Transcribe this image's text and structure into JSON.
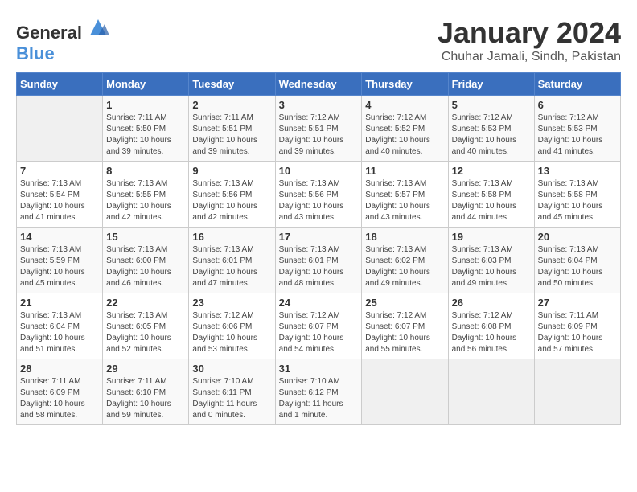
{
  "header": {
    "logo_general": "General",
    "logo_blue": "Blue",
    "month": "January 2024",
    "location": "Chuhar Jamali, Sindh, Pakistan"
  },
  "days_of_week": [
    "Sunday",
    "Monday",
    "Tuesday",
    "Wednesday",
    "Thursday",
    "Friday",
    "Saturday"
  ],
  "weeks": [
    [
      {
        "day": "",
        "sunrise": "",
        "sunset": "",
        "daylight": ""
      },
      {
        "day": "1",
        "sunrise": "Sunrise: 7:11 AM",
        "sunset": "Sunset: 5:50 PM",
        "daylight": "Daylight: 10 hours and 39 minutes."
      },
      {
        "day": "2",
        "sunrise": "Sunrise: 7:11 AM",
        "sunset": "Sunset: 5:51 PM",
        "daylight": "Daylight: 10 hours and 39 minutes."
      },
      {
        "day": "3",
        "sunrise": "Sunrise: 7:12 AM",
        "sunset": "Sunset: 5:51 PM",
        "daylight": "Daylight: 10 hours and 39 minutes."
      },
      {
        "day": "4",
        "sunrise": "Sunrise: 7:12 AM",
        "sunset": "Sunset: 5:52 PM",
        "daylight": "Daylight: 10 hours and 40 minutes."
      },
      {
        "day": "5",
        "sunrise": "Sunrise: 7:12 AM",
        "sunset": "Sunset: 5:53 PM",
        "daylight": "Daylight: 10 hours and 40 minutes."
      },
      {
        "day": "6",
        "sunrise": "Sunrise: 7:12 AM",
        "sunset": "Sunset: 5:53 PM",
        "daylight": "Daylight: 10 hours and 41 minutes."
      }
    ],
    [
      {
        "day": "7",
        "sunrise": "Sunrise: 7:13 AM",
        "sunset": "Sunset: 5:54 PM",
        "daylight": "Daylight: 10 hours and 41 minutes."
      },
      {
        "day": "8",
        "sunrise": "Sunrise: 7:13 AM",
        "sunset": "Sunset: 5:55 PM",
        "daylight": "Daylight: 10 hours and 42 minutes."
      },
      {
        "day": "9",
        "sunrise": "Sunrise: 7:13 AM",
        "sunset": "Sunset: 5:56 PM",
        "daylight": "Daylight: 10 hours and 42 minutes."
      },
      {
        "day": "10",
        "sunrise": "Sunrise: 7:13 AM",
        "sunset": "Sunset: 5:56 PM",
        "daylight": "Daylight: 10 hours and 43 minutes."
      },
      {
        "day": "11",
        "sunrise": "Sunrise: 7:13 AM",
        "sunset": "Sunset: 5:57 PM",
        "daylight": "Daylight: 10 hours and 43 minutes."
      },
      {
        "day": "12",
        "sunrise": "Sunrise: 7:13 AM",
        "sunset": "Sunset: 5:58 PM",
        "daylight": "Daylight: 10 hours and 44 minutes."
      },
      {
        "day": "13",
        "sunrise": "Sunrise: 7:13 AM",
        "sunset": "Sunset: 5:58 PM",
        "daylight": "Daylight: 10 hours and 45 minutes."
      }
    ],
    [
      {
        "day": "14",
        "sunrise": "Sunrise: 7:13 AM",
        "sunset": "Sunset: 5:59 PM",
        "daylight": "Daylight: 10 hours and 45 minutes."
      },
      {
        "day": "15",
        "sunrise": "Sunrise: 7:13 AM",
        "sunset": "Sunset: 6:00 PM",
        "daylight": "Daylight: 10 hours and 46 minutes."
      },
      {
        "day": "16",
        "sunrise": "Sunrise: 7:13 AM",
        "sunset": "Sunset: 6:01 PM",
        "daylight": "Daylight: 10 hours and 47 minutes."
      },
      {
        "day": "17",
        "sunrise": "Sunrise: 7:13 AM",
        "sunset": "Sunset: 6:01 PM",
        "daylight": "Daylight: 10 hours and 48 minutes."
      },
      {
        "day": "18",
        "sunrise": "Sunrise: 7:13 AM",
        "sunset": "Sunset: 6:02 PM",
        "daylight": "Daylight: 10 hours and 49 minutes."
      },
      {
        "day": "19",
        "sunrise": "Sunrise: 7:13 AM",
        "sunset": "Sunset: 6:03 PM",
        "daylight": "Daylight: 10 hours and 49 minutes."
      },
      {
        "day": "20",
        "sunrise": "Sunrise: 7:13 AM",
        "sunset": "Sunset: 6:04 PM",
        "daylight": "Daylight: 10 hours and 50 minutes."
      }
    ],
    [
      {
        "day": "21",
        "sunrise": "Sunrise: 7:13 AM",
        "sunset": "Sunset: 6:04 PM",
        "daylight": "Daylight: 10 hours and 51 minutes."
      },
      {
        "day": "22",
        "sunrise": "Sunrise: 7:13 AM",
        "sunset": "Sunset: 6:05 PM",
        "daylight": "Daylight: 10 hours and 52 minutes."
      },
      {
        "day": "23",
        "sunrise": "Sunrise: 7:12 AM",
        "sunset": "Sunset: 6:06 PM",
        "daylight": "Daylight: 10 hours and 53 minutes."
      },
      {
        "day": "24",
        "sunrise": "Sunrise: 7:12 AM",
        "sunset": "Sunset: 6:07 PM",
        "daylight": "Daylight: 10 hours and 54 minutes."
      },
      {
        "day": "25",
        "sunrise": "Sunrise: 7:12 AM",
        "sunset": "Sunset: 6:07 PM",
        "daylight": "Daylight: 10 hours and 55 minutes."
      },
      {
        "day": "26",
        "sunrise": "Sunrise: 7:12 AM",
        "sunset": "Sunset: 6:08 PM",
        "daylight": "Daylight: 10 hours and 56 minutes."
      },
      {
        "day": "27",
        "sunrise": "Sunrise: 7:11 AM",
        "sunset": "Sunset: 6:09 PM",
        "daylight": "Daylight: 10 hours and 57 minutes."
      }
    ],
    [
      {
        "day": "28",
        "sunrise": "Sunrise: 7:11 AM",
        "sunset": "Sunset: 6:09 PM",
        "daylight": "Daylight: 10 hours and 58 minutes."
      },
      {
        "day": "29",
        "sunrise": "Sunrise: 7:11 AM",
        "sunset": "Sunset: 6:10 PM",
        "daylight": "Daylight: 10 hours and 59 minutes."
      },
      {
        "day": "30",
        "sunrise": "Sunrise: 7:10 AM",
        "sunset": "Sunset: 6:11 PM",
        "daylight": "Daylight: 11 hours and 0 minutes."
      },
      {
        "day": "31",
        "sunrise": "Sunrise: 7:10 AM",
        "sunset": "Sunset: 6:12 PM",
        "daylight": "Daylight: 11 hours and 1 minute."
      },
      {
        "day": "",
        "sunrise": "",
        "sunset": "",
        "daylight": ""
      },
      {
        "day": "",
        "sunrise": "",
        "sunset": "",
        "daylight": ""
      },
      {
        "day": "",
        "sunrise": "",
        "sunset": "",
        "daylight": ""
      }
    ]
  ]
}
